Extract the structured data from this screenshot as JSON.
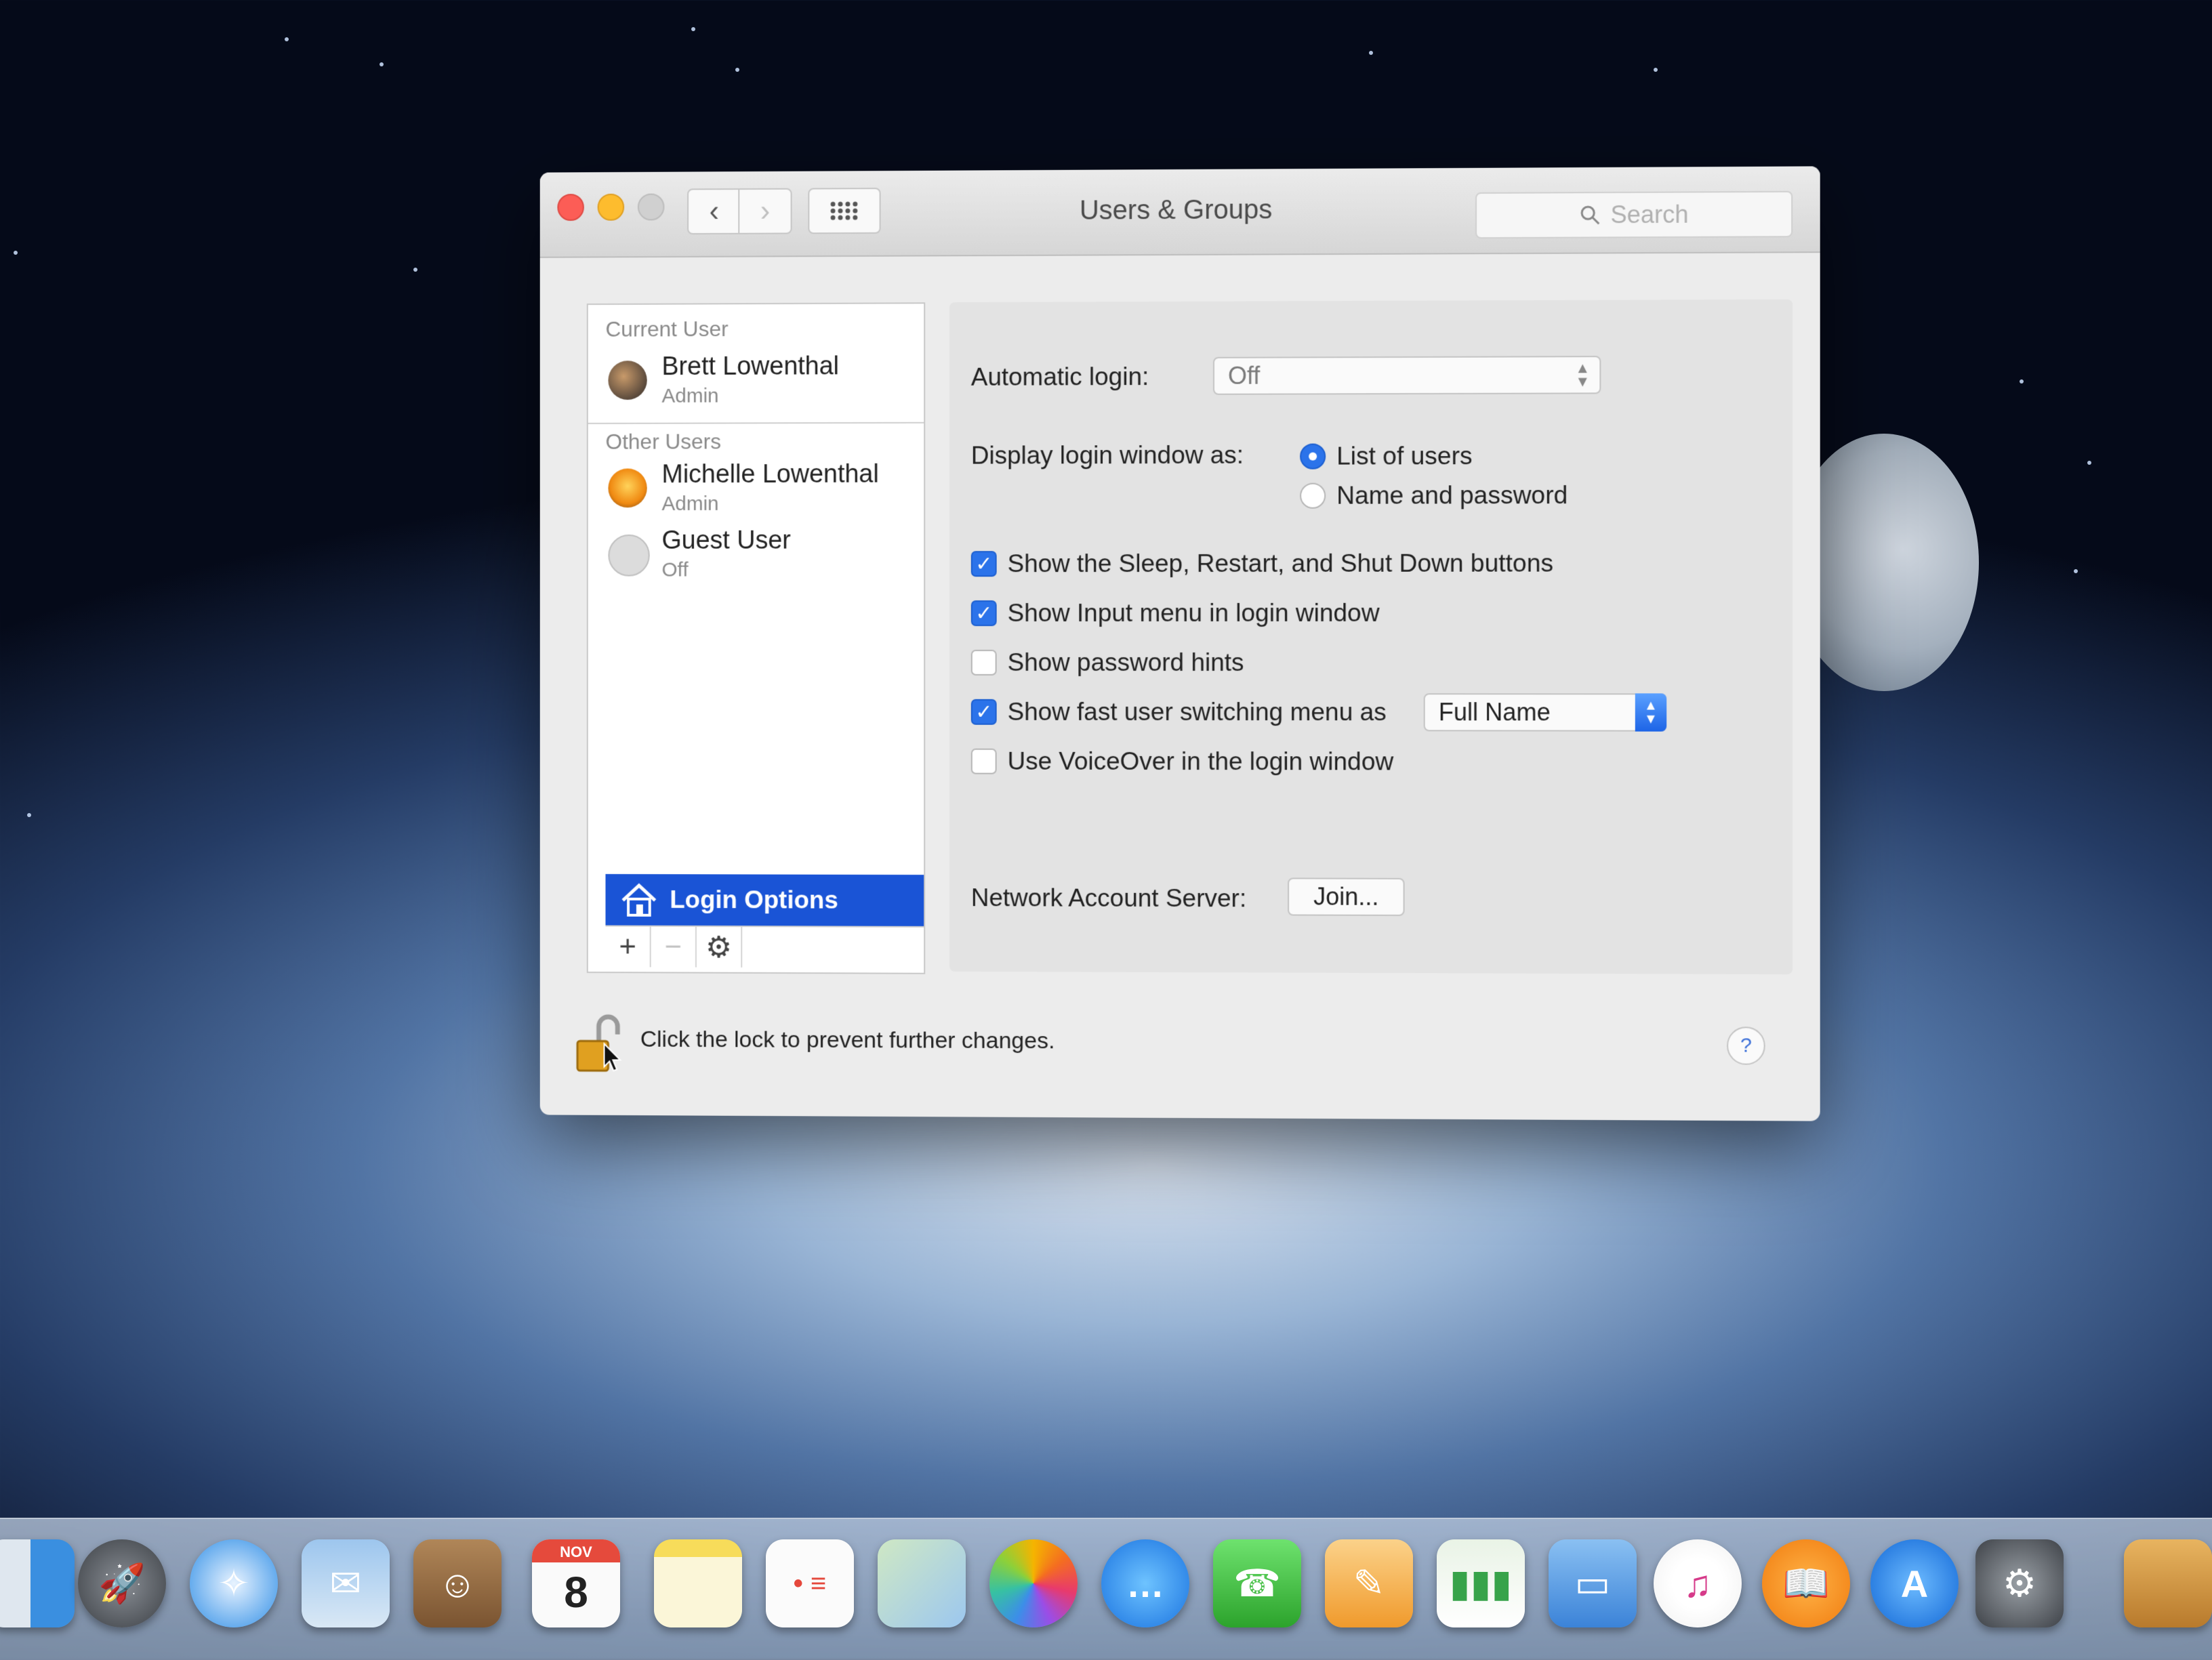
{
  "window": {
    "title": "Users & Groups",
    "search_placeholder": "Search",
    "nav_back": "‹",
    "nav_forward": "›"
  },
  "sidebar": {
    "current_user_header": "Current User",
    "current_user": {
      "name": "Brett Lowenthal",
      "role": "Admin"
    },
    "other_users_header": "Other Users",
    "other_users": [
      {
        "name": "Michelle Lowenthal",
        "role": "Admin"
      },
      {
        "name": "Guest User",
        "role": "Off"
      }
    ],
    "login_options_label": "Login Options",
    "add_label": "+",
    "remove_label": "−",
    "action_label": "⚙"
  },
  "login_panel": {
    "automatic_login_label": "Automatic login:",
    "automatic_login_value": "Off",
    "display_login_label": "Display login window as:",
    "display_options": [
      {
        "label": "List of users",
        "selected": true
      },
      {
        "label": "Name and password",
        "selected": false
      }
    ],
    "checkboxes": [
      {
        "label": "Show the Sleep, Restart, and Shut Down buttons",
        "checked": true
      },
      {
        "label": "Show Input menu in login window",
        "checked": true
      },
      {
        "label": "Show password hints",
        "checked": false
      },
      {
        "label": "Show fast user switching menu as",
        "checked": true
      },
      {
        "label": "Use VoiceOver in the login window",
        "checked": false
      }
    ],
    "fast_switch_value": "Full Name",
    "network_server_label": "Network Account Server:",
    "join_button": "Join..."
  },
  "footer": {
    "lock_text": "Click the lock to prevent further changes.",
    "help_label": "?"
  },
  "dock": {
    "calendar_month": "NOV",
    "calendar_day": "8",
    "apps": [
      "finder-icon",
      "launchpad-icon",
      "safari-icon",
      "mail-icon",
      "contacts-icon",
      "calendar-icon",
      "notes-icon",
      "reminders-icon",
      "maps-icon",
      "photos-icon",
      "messages-icon",
      "facetime-icon",
      "pages-icon",
      "numbers-icon",
      "keynote-icon",
      "itunes-icon",
      "ibooks-icon",
      "app-store-icon",
      "system-preferences-icon",
      "archive-icon"
    ]
  },
  "colors": {
    "accent": "#1a54d6",
    "close": "#fc5d56",
    "minimize": "#fdbc2e"
  }
}
